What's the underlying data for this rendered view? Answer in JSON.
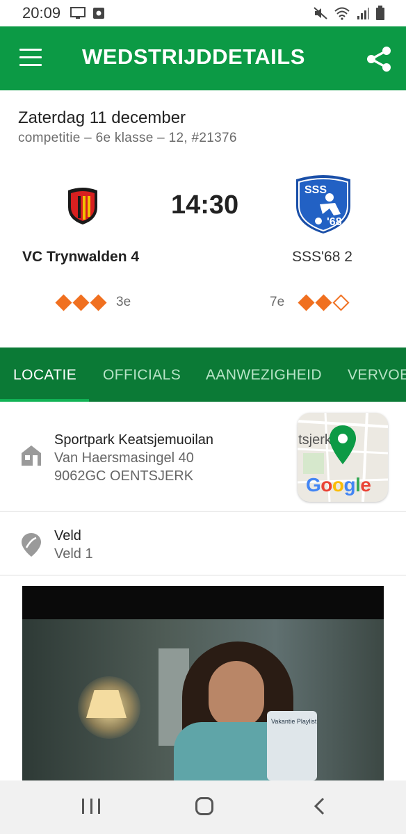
{
  "status_bar": {
    "time": "20:09"
  },
  "app_bar": {
    "title": "WEDSTRIJDDETAILS",
    "background_color": "#0c9a45"
  },
  "match": {
    "date": "Zaterdag 11 december",
    "subtitle": "competitie – 6e klasse – 12, #21376",
    "kickoff": "14:30",
    "home_team": {
      "name": "VC Trynwalden 4",
      "rank": "3e",
      "strength": 3,
      "strength_max": 3
    },
    "away_team": {
      "name": "SSS'68 2",
      "rank": "7e",
      "strength": 2,
      "strength_max": 3
    },
    "accent_color": "#f07020"
  },
  "tabs": {
    "items": [
      {
        "label": "LOCATIE",
        "active": true
      },
      {
        "label": "OFFICIALS",
        "active": false
      },
      {
        "label": "AANWEZIGHEID",
        "active": false
      },
      {
        "label": "VERVOE",
        "active": false
      }
    ],
    "background_color": "#0b7a36"
  },
  "location": {
    "name": "Sportpark Keatsjemuoilan",
    "address_line1": "Van Haersmasingel 40",
    "address_line2": "9062GC OENTSJERK",
    "map_label": "ntsjerk",
    "map_brand": "Google"
  },
  "field": {
    "label": "Veld",
    "value": "Veld 1"
  },
  "ad": {
    "device_label": "Vakantie Playlist"
  }
}
